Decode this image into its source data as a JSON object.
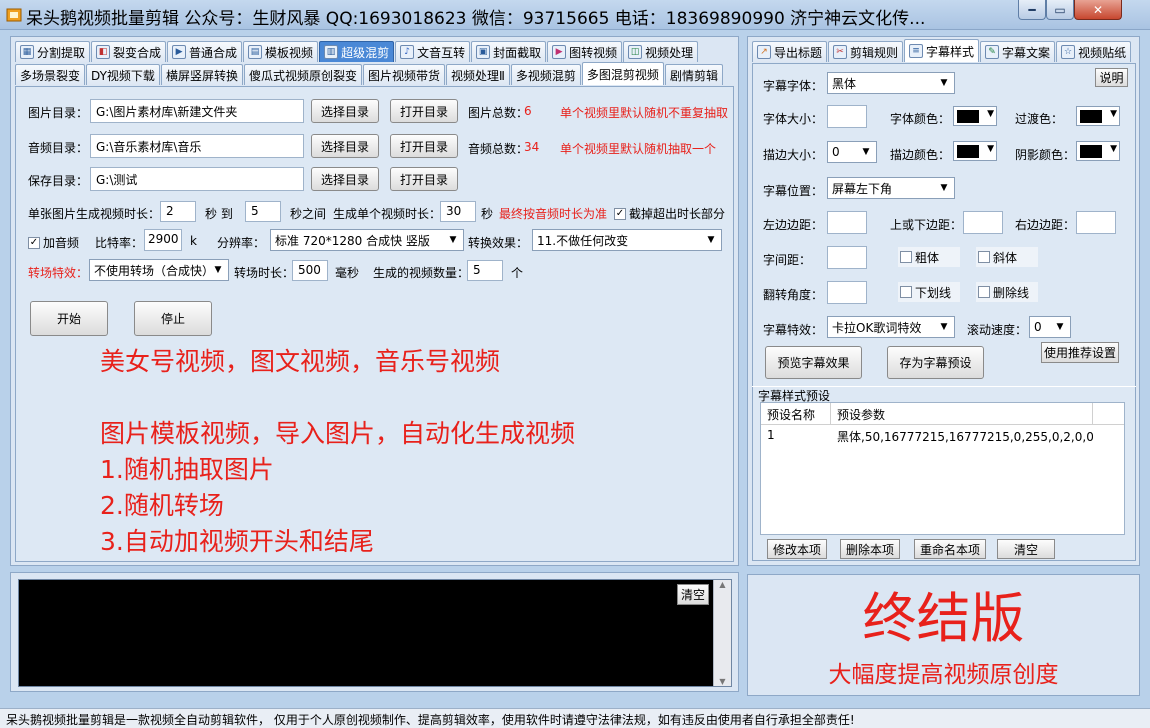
{
  "window": {
    "title": "呆头鹅视频批量剪辑 公众号：生财风暴 QQ:1693018623 微信：93715665 电话：18369890990 济宁神云文化传..."
  },
  "main_tabs": [
    {
      "label": "分割提取",
      "icon": "split-icon"
    },
    {
      "label": "裂变合成",
      "icon": "fission-icon"
    },
    {
      "label": "普通合成",
      "icon": "play-icon"
    },
    {
      "label": "模板视频",
      "icon": "template-icon"
    },
    {
      "label": "超级混剪",
      "icon": "audio-bars-icon"
    },
    {
      "label": "文音互转",
      "icon": "microphone-icon"
    },
    {
      "label": "封面截取",
      "icon": "image-icon"
    },
    {
      "label": "图转视频",
      "icon": "photo-video-icon"
    },
    {
      "label": "视频处理",
      "icon": "video-process-icon"
    }
  ],
  "sub_tabs": [
    "多场景裂变",
    "DY视频下载",
    "横屏竖屏转换",
    "傻瓜式视频原创裂变",
    "图片视频带货",
    "视频处理Ⅱ",
    "多视频混剪",
    "多图混剪视频",
    "剧情剪辑"
  ],
  "form": {
    "image_dir_label": "图片目录：",
    "image_dir_value": "G:\\图片素材库\\新建文件夹",
    "audio_dir_label": "音频目录：",
    "audio_dir_value": "G:\\音乐素材库\\音乐",
    "save_dir_label": "保存目录：",
    "save_dir_value": "G:\\测试",
    "choose_dir": "选择目录",
    "open_dir": "打开目录",
    "image_total_label": "图片总数：",
    "image_total": "6",
    "audio_total_label": "音频总数：",
    "audio_total": "34",
    "image_note": "单个视频里默认随机不重复抽取",
    "audio_note": "单个视频里默认随机抽取一个",
    "duration_label": "单张图片生成视频时长：",
    "duration_min": "2",
    "sec_to": "秒 到",
    "duration_max": "5",
    "sec_between": "秒之间",
    "single_len_label": "生成单个视频时长：",
    "single_len": "30",
    "sec": "秒",
    "audio_len_note": "最终按音频时长为准",
    "cut_excess": "截掉超出时长部分",
    "add_audio": "加音频",
    "bitrate_label": "比特率：",
    "bitrate": "2900",
    "bitrate_unit": "k",
    "resolution_label": "分辨率：",
    "resolution": "标准 720*1280 合成快 竖版",
    "effect_label": "转换效果：",
    "effect": "11.不做任何改变",
    "transition_label": "转场特效：",
    "transition": "不使用转场（合成快）",
    "transition_len_label": "转场时长：",
    "transition_len": "500",
    "ms": "毫秒",
    "count_label": "生成的视频数量：",
    "count": "5",
    "count_unit": "个",
    "start": "开始",
    "stop": "停止"
  },
  "promo": {
    "line1": "美女号视频，图文视频，音乐号视频",
    "line2": "图片模板视频，导入图片，自动化生成视频",
    "line3": "1.随机抽取图片",
    "line4": "2.随机转场",
    "line5": "3.自动加视频开头和结尾"
  },
  "log": {
    "clear": "清空"
  },
  "right_tabs": [
    {
      "label": "导出标题",
      "icon": "export-icon"
    },
    {
      "label": "剪辑规则",
      "icon": "scissors-icon"
    },
    {
      "label": "字幕样式",
      "icon": "list-icon"
    },
    {
      "label": "字幕文案",
      "icon": "edit-icon"
    },
    {
      "label": "视频贴纸",
      "icon": "star-icon"
    }
  ],
  "subtitle": {
    "font_label": "字幕字体：",
    "font_value": "黑体",
    "help": "说明",
    "size_label": "字体大小：",
    "font_color_label": "字体颜色：",
    "transition_color_label": "过渡色：",
    "stroke_size_label": "描边大小：",
    "stroke_size": "0",
    "stroke_color_label": "描边颜色：",
    "shadow_color_label": "阴影颜色：",
    "position_label": "字幕位置：",
    "position_value": "屏幕左下角",
    "lr_margin_label": "左边边距：",
    "tb_margin_label": "上或下边距：",
    "right_margin_label": "右边边距：",
    "spacing_label": "字间距：",
    "bold": "粗体",
    "italic": "斜体",
    "rotate_label": "翻转角度：",
    "underline": "下划线",
    "strike": "删除线",
    "effect_label": "字幕特效：",
    "effect_value": "卡拉OK歌词特效",
    "scroll_label": "滚动速度：",
    "scroll_value": "0",
    "preview": "预览字幕效果",
    "save_preset": "存为字幕预设",
    "use_recommended": "使用推荐设置",
    "preset_section": "字幕样式预设",
    "col_name": "预设名称",
    "col_params": "预设参数",
    "row1_name": "1",
    "row1_params": "黑体,50,16777215,16777215,0,255,0,2,0,0,...",
    "edit": "修改本项",
    "delete": "删除本项",
    "rename": "重命名本项",
    "clear": "清空"
  },
  "final": {
    "title": "终结版",
    "subtitle": "大幅度提高视频原创度"
  },
  "status": "呆头鹅视频批量剪辑是一款视频全自动剪辑软件， 仅用于个人原创视频制作、提高剪辑效率，使用软件时请遵守法律法规，如有违反由使用者自行承担全部责任!",
  "colors": {
    "red": "#e8211b",
    "active_tab": "#4a88d6"
  }
}
